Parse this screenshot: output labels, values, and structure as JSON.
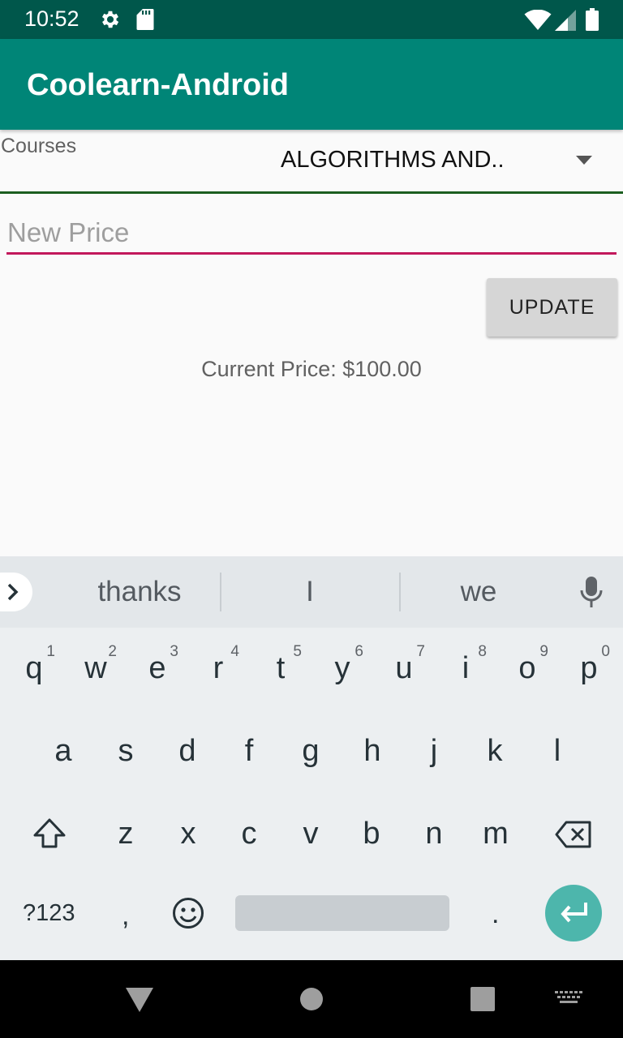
{
  "status_bar": {
    "time": "10:52"
  },
  "app_bar": {
    "title": "Coolearn-Android"
  },
  "form": {
    "courses_label": "Courses",
    "course_selected": "ALGORITHMS AND..",
    "price_placeholder": "New Price",
    "price_value": "",
    "update_label": "UPDATE",
    "current_price": "Current Price: $100.00"
  },
  "keyboard": {
    "suggestions": [
      "thanks",
      "I",
      "we"
    ],
    "row1": [
      {
        "k": "q",
        "h": "1"
      },
      {
        "k": "w",
        "h": "2"
      },
      {
        "k": "e",
        "h": "3"
      },
      {
        "k": "r",
        "h": "4"
      },
      {
        "k": "t",
        "h": "5"
      },
      {
        "k": "y",
        "h": "6"
      },
      {
        "k": "u",
        "h": "7"
      },
      {
        "k": "i",
        "h": "8"
      },
      {
        "k": "o",
        "h": "9"
      },
      {
        "k": "p",
        "h": "0"
      }
    ],
    "row2": [
      "a",
      "s",
      "d",
      "f",
      "g",
      "h",
      "j",
      "k",
      "l"
    ],
    "row3": [
      "z",
      "x",
      "c",
      "v",
      "b",
      "n",
      "m"
    ],
    "symbols_label": "?123",
    "comma": ",",
    "period": ".",
    "enter_color": "#4db6ac"
  },
  "colors": {
    "status_bar": "#00574b",
    "app_bar": "#008577",
    "accent": "#c2185b",
    "spinner_line": "#1b5e20"
  }
}
